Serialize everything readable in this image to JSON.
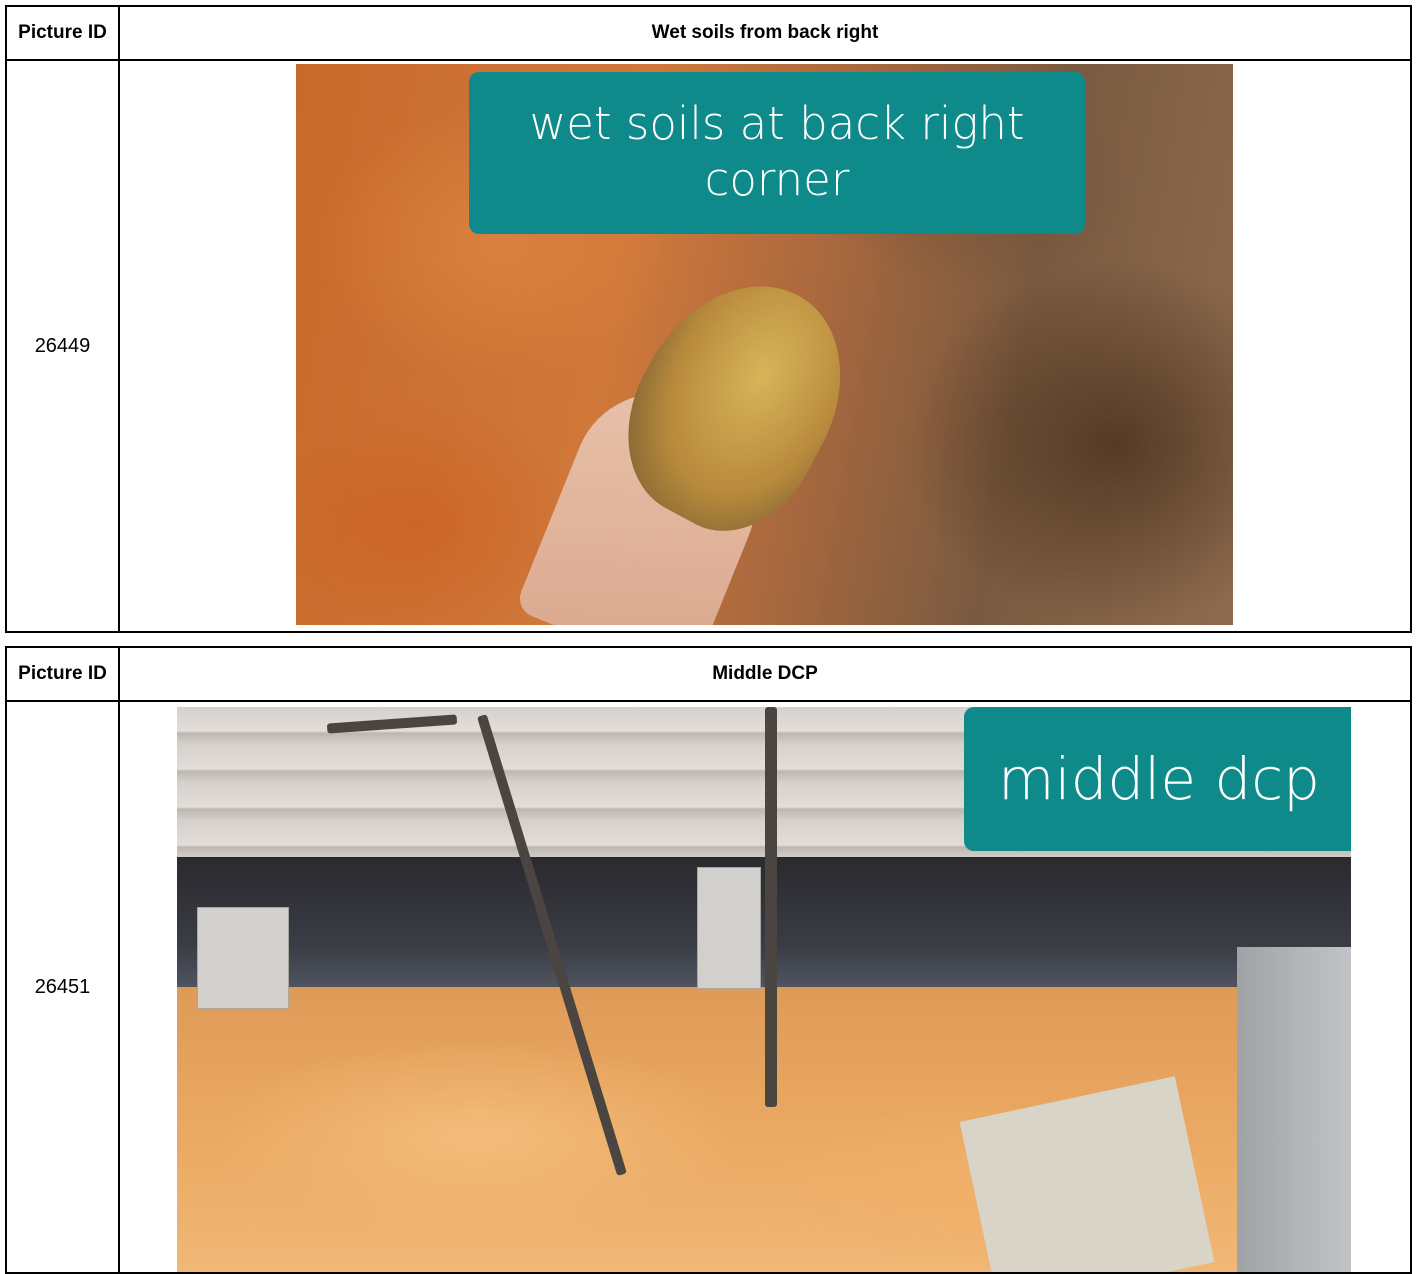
{
  "rows": [
    {
      "id_header": "Picture ID",
      "title": "Wet soils from back right",
      "picture_id": "26449",
      "photo_caption": "wet soils at back right corner"
    },
    {
      "id_header": "Picture ID",
      "title": "Middle DCP",
      "picture_id": "26451",
      "photo_caption": "middle dcp"
    }
  ]
}
